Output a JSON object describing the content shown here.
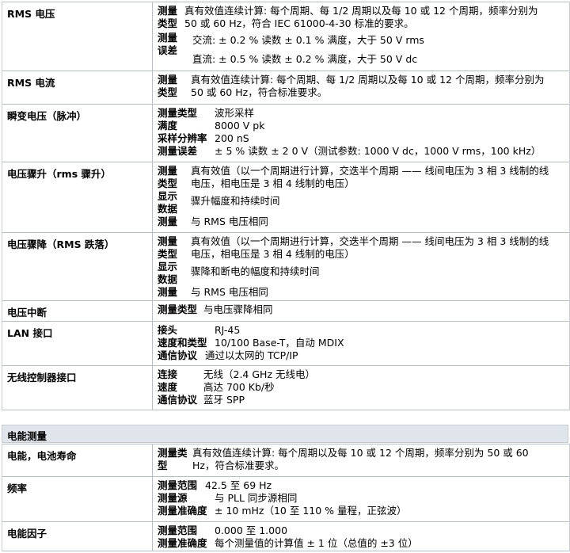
{
  "rms_voltage": {
    "label": "RMS 电压",
    "type_key": "测量\n类型",
    "type_val": "真有效值连续计算: 每个周期、每 1/2 周期以及每 10 或 12 个周期，频率分别为\n50 或 60 Hz，符合 IEC 61000-4-30 标准的要求。",
    "err_key": "测量\n误差",
    "err_ac": "交流: ± 0.2 % 读数 ± 0.1 % 满度，大于 50 V rms",
    "err_dc": "直流: ± 0.5 % 读数 ± 0.2 % 满度，大于 50 V dc"
  },
  "rms_current": {
    "label": "RMS 电流",
    "type_key": "测量\n类型",
    "type_val": "真有效值连续计算: 每个周期、每 1/2 周期以及每 10 或 12 个周期，频率分别为\n50 或 60 Hz，符合标准要求。"
  },
  "transient": {
    "label": "瞬变电压（脉冲）",
    "k1": "测量类型",
    "v1": "波形采样",
    "k2": "满度",
    "v2": "8000 V pk",
    "k3": "采样分辨率",
    "v3": "200 nS",
    "k4": "测量误差",
    "v4": "± 5 % 读数 ± 2 0 V（测试参数: 1000 V dc，1000 V rms，100 kHz）"
  },
  "swell": {
    "label": "电压骤升（rms 骤升）",
    "type_key": "测量\n类型",
    "type_val": "真有效值（以一个周期进行计算，交迭半个周期 —— 线间电压为 3 相 3 线制的线\n电压，相电压是 3 相 4 线制的电压）",
    "disp_key": "显示\n数据",
    "disp_val": "骤升幅度和持续时间",
    "meas_key": "测量",
    "meas_val": "与 RMS 电压相同"
  },
  "sag": {
    "label": "电压骤降（RMS 跌落）",
    "type_key": "测量\n类型",
    "type_val": "真有效值（以一个周期进行计算，交迭半个周期 —— 线间电压为 3 相 3 线制的线\n电压，相电压是 3 相 4 线制的电压）",
    "disp_key": "显示\n数据",
    "disp_val": "骤降和断电的幅度和持续时间",
    "meas_key": "测量",
    "meas_val": "与 RMS 电压相同"
  },
  "interruption": {
    "label": "电压中断",
    "k1": "测量类型",
    "v1": "与电压骤降相同"
  },
  "lan": {
    "label": "LAN 接口",
    "k1": "接头",
    "v1": "RJ-45",
    "k2": "速度和类型",
    "v2": "10/100 Base-T，自动 MDIX",
    "k3": "通信协议",
    "v3": "通过以太网的 TCP/IP"
  },
  "wireless": {
    "label": "无线控制器接口",
    "k1": "连接",
    "v1": "无线（2.4 GHz 无线电）",
    "k2": "速度",
    "v2": "高达 700 Kb/秒",
    "k3": "通信协议",
    "v3": "蓝牙 SPP"
  },
  "section_energy": "电能测量",
  "energy": {
    "label": "电能，电池寿命",
    "type_key": "测量类\n型",
    "type_val": "真有效值连续计算: 每个周期以及每 10 或 12 个周期，频率分别为 50 或 60\nHz，符合标准要求。"
  },
  "frequency": {
    "label": "频率",
    "k1": "测量范围",
    "v1": "42.5 至 69 Hz",
    "k2": "测量源",
    "v2": "与 PLL 同步源相同",
    "k3": "测量准确度",
    "v3": "± 10 mHz（10 至 110 % 量程，正弦波）"
  },
  "power_factor": {
    "label": "电能因子",
    "k1": "测量范围",
    "v1": "0.000 至 1.000",
    "k2": "测量准确度",
    "v2": "每个测量值的计算值 ± 1 位（总值的 ±3 位）"
  }
}
